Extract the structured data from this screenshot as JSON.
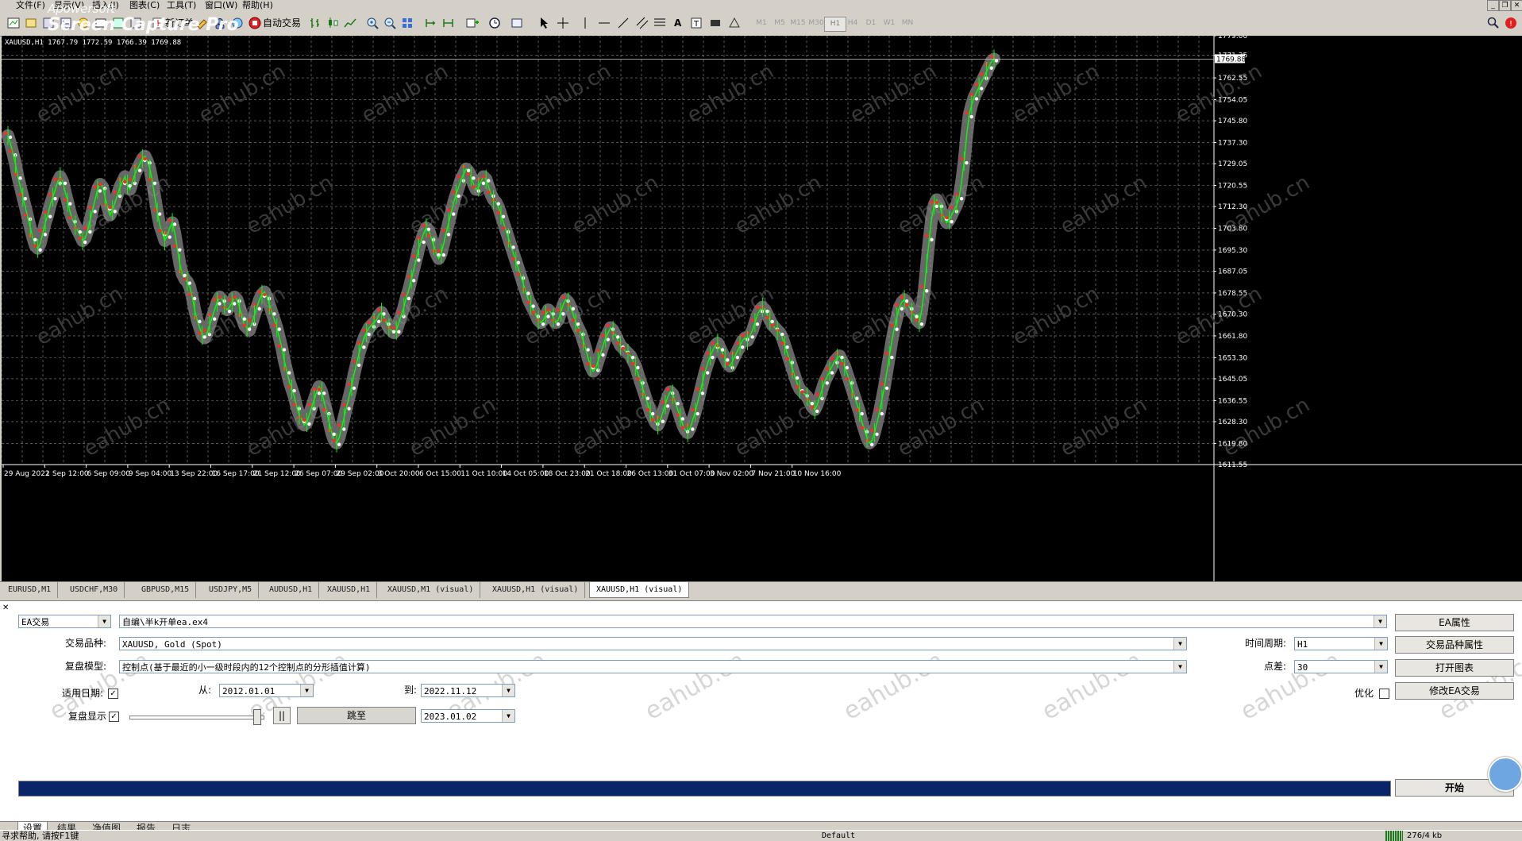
{
  "menu": {
    "file": "文件(F)",
    "view": "显示(V)",
    "insert": "插入(I)",
    "charts": "图表(C)",
    "tools": "工具(T)",
    "window": "窗口(W)",
    "help": "帮助(H)"
  },
  "watermark_logo": {
    "line1": "Apowersoft",
    "line2": "Screen Capture Pro"
  },
  "toolbar": {
    "new_order": "新订单",
    "auto_trading": "自动交易",
    "timeframes": [
      "M1",
      "M5",
      "M15",
      "M30",
      "H1",
      "H4",
      "D1",
      "W1",
      "MN"
    ],
    "active_timeframe": "H1"
  },
  "chart": {
    "info": "XAUUSD,H1  1767.79 1772.59 1766.39 1769.88",
    "current_price": "1769.88",
    "background": "#000000",
    "grid_color": "#c0c0c0",
    "bull_color": "#00ff00",
    "watermark_text": "eahub.cn"
  },
  "chart_data": {
    "type": "line",
    "symbol": "XAUUSD",
    "timeframe": "H1",
    "x_labels": [
      "29 Aug 2022",
      "1 Sep 12:00",
      "6 Sep 09:00",
      "9 Sep 04:00",
      "13 Sep 22:00",
      "16 Sep 17:00",
      "21 Sep 12:00",
      "26 Sep 07:00",
      "29 Sep 02:00",
      "3 Oct 20:00",
      "6 Oct 15:00",
      "11 Oct 10:00",
      "14 Oct 05:00",
      "18 Oct 23:00",
      "21 Oct 18:00",
      "26 Oct 13:00",
      "31 Oct 07:00",
      "3 Nov 02:00",
      "7 Nov 21:00",
      "10 Nov 16:00"
    ],
    "y_ticks": [
      "1779.00",
      "1771.35",
      "1762.55",
      "1754.05",
      "1745.80",
      "1737.30",
      "1729.05",
      "1720.55",
      "1712.30",
      "1703.80",
      "1695.30",
      "1687.05",
      "1678.55",
      "1670.30",
      "1661.80",
      "1653.30",
      "1645.05",
      "1636.55",
      "1628.30",
      "1619.80",
      "1611.55"
    ],
    "ylim": [
      1611.55,
      1779.0
    ],
    "series": [
      {
        "values": [
          1740,
          1737,
          1733,
          1729,
          1724,
          1720,
          1716,
          1712,
          1708,
          1704,
          1700,
          1697,
          1696,
          1698,
          1702,
          1706,
          1709,
          1713,
          1716,
          1719,
          1722,
          1724,
          1722,
          1718,
          1714,
          1710,
          1707,
          1705,
          1703,
          1701,
          1699,
          1700,
          1703,
          1707,
          1711,
          1715,
          1719,
          1721,
          1720,
          1716,
          1712,
          1709,
          1711,
          1714,
          1717,
          1720,
          1722,
          1724,
          1721,
          1719,
          1722,
          1725,
          1727,
          1729,
          1731,
          1732,
          1730,
          1727,
          1722,
          1716,
          1710,
          1705,
          1702,
          1699,
          1701,
          1704,
          1706,
          1702,
          1696,
          1690,
          1686,
          1684,
          1683,
          1681,
          1677,
          1672,
          1668,
          1665,
          1662,
          1661,
          1663,
          1666,
          1669,
          1672,
          1675,
          1677,
          1676,
          1674,
          1672,
          1673,
          1675,
          1677,
          1676,
          1673,
          1669,
          1666,
          1665,
          1664,
          1667,
          1670,
          1673,
          1676,
          1678,
          1679,
          1677,
          1674,
          1671,
          1668,
          1665,
          1661,
          1657,
          1652,
          1648,
          1644,
          1641,
          1638,
          1634,
          1631,
          1629,
          1627,
          1628,
          1631,
          1634,
          1637,
          1640,
          1642,
          1640,
          1636,
          1632,
          1628,
          1624,
          1621,
          1620,
          1622,
          1626,
          1630,
          1634,
          1638,
          1642,
          1647,
          1651,
          1655,
          1658,
          1661,
          1663,
          1665,
          1666,
          1667,
          1668,
          1670,
          1671,
          1669,
          1667,
          1665,
          1664,
          1663,
          1664,
          1667,
          1670,
          1673,
          1677,
          1680,
          1684,
          1688,
          1692,
          1696,
          1699,
          1702,
          1704,
          1703,
          1700,
          1697,
          1694,
          1692,
          1694,
          1698,
          1702,
          1706,
          1710,
          1714,
          1717,
          1720,
          1723,
          1725,
          1727,
          1726,
          1724,
          1721,
          1719,
          1720,
          1722,
          1724,
          1723,
          1720,
          1717,
          1715,
          1714,
          1712,
          1709,
          1706,
          1703,
          1700,
          1697,
          1694,
          1691,
          1688,
          1685,
          1682,
          1679,
          1676,
          1674,
          1672,
          1670,
          1668,
          1667,
          1668,
          1670,
          1672,
          1671,
          1669,
          1667,
          1668,
          1671,
          1674,
          1676,
          1675,
          1673,
          1670,
          1667,
          1665,
          1663,
          1660,
          1657,
          1653,
          1650,
          1648,
          1649,
          1652,
          1655,
          1658,
          1661,
          1663,
          1665,
          1664,
          1662,
          1660,
          1658,
          1657,
          1656,
          1655,
          1654,
          1652,
          1650,
          1647,
          1644,
          1641,
          1638,
          1635,
          1632,
          1630,
          1628,
          1627,
          1629,
          1632,
          1635,
          1638,
          1640,
          1639,
          1636,
          1633,
          1630,
          1627,
          1625,
          1624,
          1626,
          1629,
          1632,
          1636,
          1640,
          1644,
          1648,
          1651,
          1654,
          1656,
          1658,
          1659,
          1657,
          1655,
          1653,
          1651,
          1650,
          1652,
          1654,
          1656,
          1658,
          1660,
          1661,
          1660,
          1662,
          1664,
          1667,
          1670,
          1672,
          1673,
          1672,
          1670,
          1668,
          1666,
          1665,
          1664,
          1663,
          1661,
          1658,
          1655,
          1652,
          1649,
          1646,
          1643,
          1641,
          1640,
          1639,
          1638,
          1636,
          1634,
          1633,
          1635,
          1638,
          1641,
          1644,
          1646,
          1648,
          1650,
          1652,
          1653,
          1654,
          1652,
          1650,
          1647,
          1644,
          1641,
          1638,
          1635,
          1632,
          1628,
          1625,
          1622,
          1620,
          1621,
          1624,
          1628,
          1632,
          1637,
          1642,
          1648,
          1654,
          1660,
          1665,
          1669,
          1673,
          1675,
          1676,
          1675,
          1673,
          1671,
          1670,
          1668,
          1667,
          1672,
          1680,
          1690,
          1700,
          1708,
          1713,
          1715,
          1713,
          1710,
          1708,
          1706,
          1707,
          1709,
          1711,
          1713,
          1716,
          1722,
          1730,
          1740,
          1748,
          1752,
          1755,
          1757,
          1759,
          1761,
          1763,
          1765,
          1767,
          1769,
          1769.88
        ]
      }
    ]
  },
  "symbol_tabs": [
    "EURUSD,M1",
    "USDCHF,M30",
    "GBPUSD,M15",
    "USDJPY,M5",
    "AUDUSD,H1",
    "XAUUSD,H1",
    "XAUUSD,M1 (visual)",
    "XAUUSD,H1 (visual)",
    "XAUUSD,H1 (visual)"
  ],
  "active_symbol_tab": 8,
  "tester": {
    "ea_type": "EA交易",
    "ea_file": "自编\\半k开单ea.ex4",
    "symbol_label": "交易品种:",
    "symbol_value": "XAUUSD, Gold (Spot)",
    "model_label": "复盘模型:",
    "model_value": "控制点(基于最近的小一级时段内的12个控制点的分形插值计算)",
    "use_date_label": "适用日期:",
    "use_date_checked": true,
    "from_label": "从:",
    "from_value": "2012.01.01",
    "to_label": "到:",
    "to_value": "2022.11.12",
    "visual_label": "复盘显示",
    "visual_checked": true,
    "speed_level": 0.95,
    "pause_label": "||",
    "jump_label": "跳至",
    "jump_date": "2023.01.02",
    "period_label": "时间周期:",
    "period_value": "H1",
    "spread_label": "点差:",
    "spread_value": "30",
    "optimize_label": "优化",
    "optimize_checked": false,
    "btn_ea_props": "EA属性",
    "btn_symbol_props": "交易品种属性",
    "btn_open_chart": "打开图表",
    "btn_modify_ea": "修改EA交易",
    "btn_start": "开始",
    "progress": 1.0,
    "progress_color": "#0a246a",
    "watermark_text": "eahub.cn"
  },
  "bottom_tabs": [
    "设置",
    "结果",
    "净值图",
    "报告",
    "日志"
  ],
  "active_bottom_tab": 0,
  "status": {
    "help_text": "寻求帮助, 请按F1键",
    "profile": "Default",
    "connection": "276/4 kb"
  }
}
